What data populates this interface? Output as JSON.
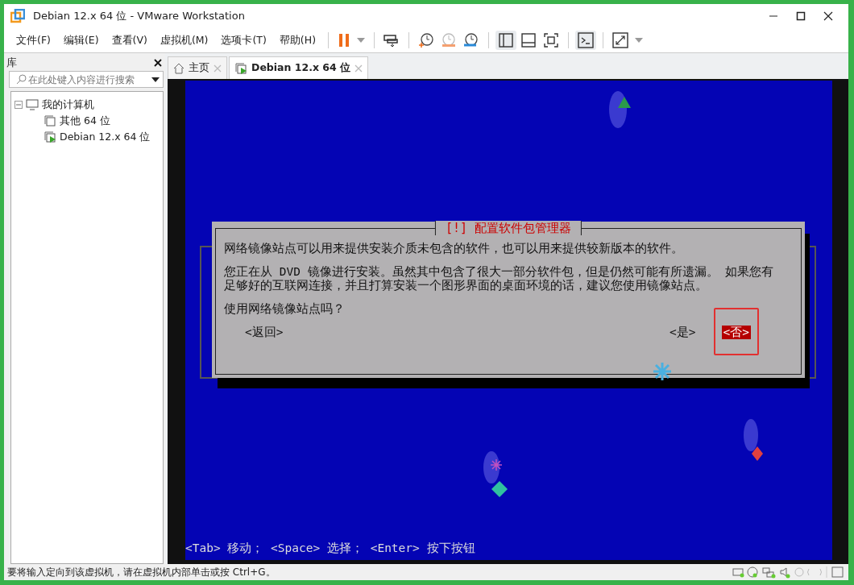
{
  "window": {
    "title": "Debian 12.x 64 位 - VMware Workstation"
  },
  "menus": [
    "文件(F)",
    "编辑(E)",
    "查看(V)",
    "虚拟机(M)",
    "选项卡(T)",
    "帮助(H)"
  ],
  "sidebar": {
    "title": "库",
    "search": {
      "placeholder": "在此处键入内容进行搜索"
    },
    "tree": [
      {
        "label": "我的计算机",
        "kind": "computer",
        "expanded": true,
        "children": [
          {
            "label": "其他 64 位",
            "kind": "vm"
          },
          {
            "label": "Debian 12.x 64 位",
            "kind": "vm-running"
          }
        ]
      }
    ]
  },
  "tabs": [
    {
      "label": "主页",
      "kind": "home",
      "selected": false
    },
    {
      "label": "Debian 12.x 64 位",
      "kind": "vm-running",
      "selected": true
    }
  ],
  "dialog": {
    "title": "[!] 配置软件包管理器",
    "paragraphs": [
      "网络镜像站点可以用来提供安装介质未包含的软件，也可以用来提供较新版本的软件。",
      "您正在从 DVD 镜像进行安装。虽然其中包含了很大一部分软件包，但是仍然可能有所遗漏。 如果您有足够好的互联网连接，并且打算安装一个图形界面的桌面环境的话，建议您使用镜像站点。",
      "使用网络镜像站点吗？"
    ],
    "buttons": [
      {
        "label": "<返回>",
        "selected": false
      },
      {
        "label": "<是>",
        "selected": false
      },
      {
        "label": "<否>",
        "selected": true
      }
    ]
  },
  "hint": "<Tab> 移动； <Space> 选择； <Enter> 按下按钮",
  "status_bar": "要将输入定向到该虚拟机，请在虚拟机内部单击或按 Ctrl+G。"
}
